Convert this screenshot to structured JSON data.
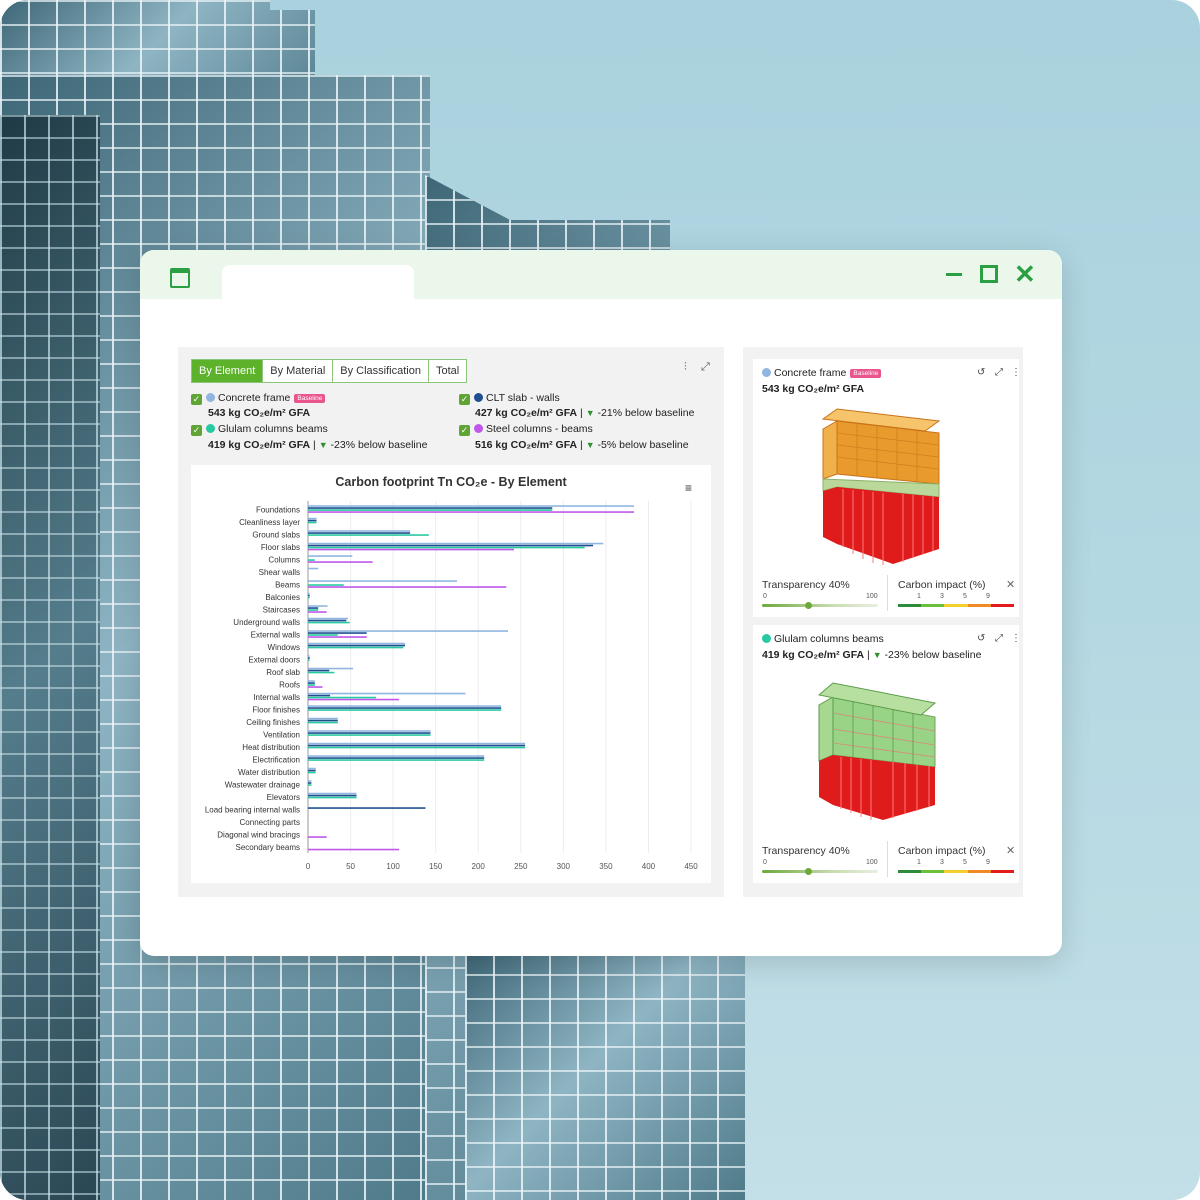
{
  "window": {
    "tabs": [
      "By Element",
      "By Material",
      "By Classification",
      "Total"
    ],
    "active_tab": "By Element"
  },
  "legend": [
    {
      "name": "Concrete frame",
      "color": "#8fb5e0",
      "badge": "Baseline",
      "value": "543 kg CO₂e/m² GFA",
      "delta": ""
    },
    {
      "name": "CLT slab - walls",
      "color": "#1f4f8f",
      "badge": "",
      "value": "427 kg CO₂e/m² GFA",
      "delta": "-21% below baseline"
    },
    {
      "name": "Glulam columns beams",
      "color": "#27c9a0",
      "badge": "",
      "value": "419 kg CO₂e/m² GFA",
      "delta": "-23% below baseline"
    },
    {
      "name": "Steel columns - beams",
      "color": "#c156e8",
      "badge": "",
      "value": "516 kg CO₂e/m² GFA",
      "delta": "-5% below baseline"
    }
  ],
  "chart_data": {
    "type": "bar",
    "orientation": "horizontal",
    "title": "Carbon footprint Tn CO₂e - By Element",
    "xlim": [
      0,
      450
    ],
    "xticks": [
      0,
      50,
      100,
      150,
      200,
      250,
      300,
      350,
      400,
      450
    ],
    "grid": true,
    "categories": [
      "Foundations",
      "Cleanliness layer",
      "Ground slabs",
      "Floor slabs",
      "Columns",
      "Shear walls",
      "Beams",
      "Balconies",
      "Staircases",
      "Underground walls",
      "External walls",
      "Windows",
      "External doors",
      "Roof slab",
      "Roofs",
      "Internal walls",
      "Floor finishes",
      "Ceiling finishes",
      "Ventilation",
      "Heat distribution",
      "Electrification",
      "Water distribution",
      "Wastewater drainage",
      "Elevators",
      "Load bearing internal walls",
      "Connecting parts",
      "Diagonal wind bracings",
      "Secondary beams"
    ],
    "series": [
      {
        "name": "Concrete frame",
        "color": "#8fb5e0",
        "values": [
          383,
          10,
          120,
          347,
          52,
          12,
          175,
          2,
          23,
          47,
          235,
          114,
          2,
          53,
          8,
          185,
          227,
          35,
          144,
          255,
          207,
          9,
          4,
          57,
          0,
          0,
          0,
          0
        ]
      },
      {
        "name": "CLT slab - walls",
        "color": "#1f4f8f",
        "values": [
          287,
          10,
          120,
          335,
          0,
          0,
          0,
          2,
          12,
          45,
          69,
          114,
          2,
          25,
          8,
          26,
          227,
          35,
          144,
          255,
          207,
          9,
          4,
          57,
          138,
          0,
          0,
          0
        ]
      },
      {
        "name": "Glulam columns beams",
        "color": "#27c9a0",
        "values": [
          287,
          10,
          142,
          325,
          8,
          0,
          42,
          2,
          12,
          49,
          35,
          112,
          2,
          31,
          8,
          80,
          227,
          35,
          144,
          255,
          207,
          9,
          4,
          57,
          0,
          0,
          0,
          0
        ]
      },
      {
        "name": "Steel columns - beams",
        "color": "#c156e8",
        "values": [
          383,
          0,
          0,
          242,
          76,
          0,
          233,
          0,
          22,
          0,
          69,
          0,
          0,
          0,
          17,
          107,
          0,
          0,
          0,
          0,
          0,
          0,
          0,
          0,
          0,
          0,
          22,
          107
        ]
      }
    ]
  },
  "cards": [
    {
      "title": "Concrete frame",
      "color": "#8fb5e0",
      "badge": "Baseline",
      "value": "543 kg CO₂e/m² GFA",
      "delta": "",
      "transparency_label": "Transparency 40%",
      "transparency": 40,
      "slider_min": "0",
      "slider_max": "100",
      "impact_label": "Carbon impact (%)",
      "impact_ticks": [
        "1",
        "3",
        "5",
        "9"
      ]
    },
    {
      "title": "Glulam columns beams",
      "color": "#27c9a0",
      "badge": "",
      "value": "419 kg CO₂e/m² GFA",
      "delta": "-23% below baseline",
      "transparency_label": "Transparency 40%",
      "transparency": 40,
      "slider_min": "0",
      "slider_max": "100",
      "impact_label": "Carbon impact (%)",
      "impact_ticks": [
        "1",
        "3",
        "5",
        "9"
      ]
    }
  ]
}
